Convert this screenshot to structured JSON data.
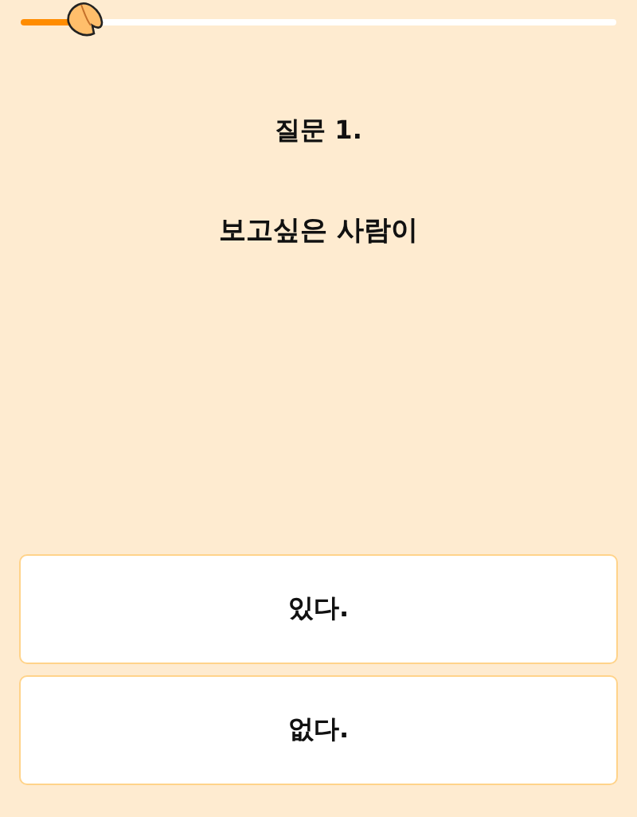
{
  "progress": {
    "level": 0.09
  },
  "question_number": "질문 1.",
  "question": "보고싶은 사람이",
  "answers": [
    {
      "label": "있다."
    },
    {
      "label": "없다."
    }
  ]
}
